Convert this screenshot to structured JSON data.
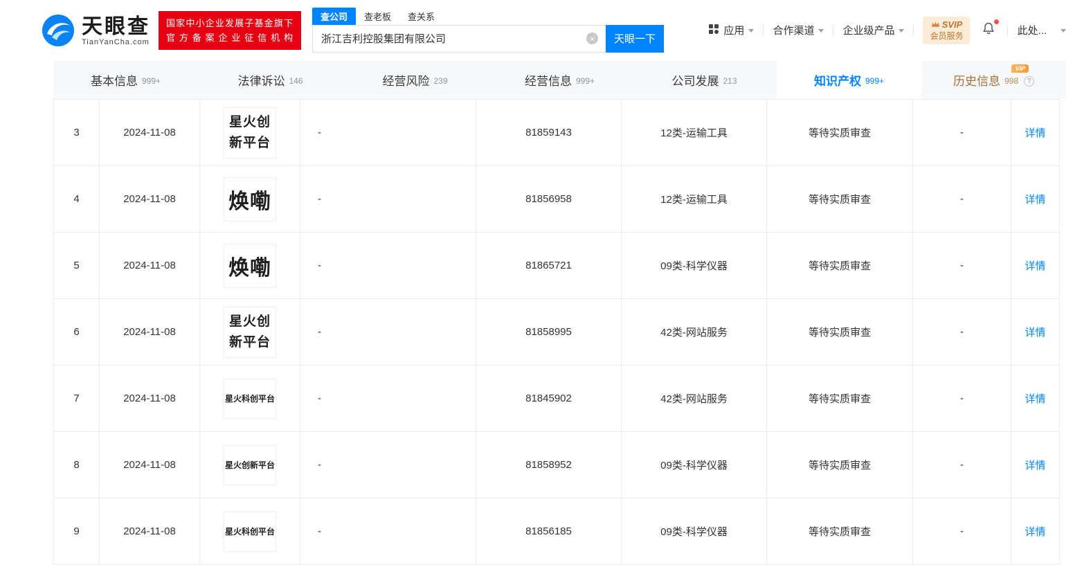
{
  "header": {
    "logo": {
      "brand_cn": "天眼查",
      "brand_en": "TianYanCha.com"
    },
    "badge": {
      "line1": "国家中小企业发展子基金旗下",
      "line2": "官方备案企业征信机构"
    },
    "search": {
      "tabs": [
        {
          "label": "查公司"
        },
        {
          "label": "查老板"
        },
        {
          "label": "查关系"
        }
      ],
      "value": "浙江吉利控股集团有限公司",
      "button_label": "天眼一下"
    },
    "nav": {
      "apps": "应用",
      "partners": "合作渠道",
      "enterprise": "企业级产品",
      "vip_line1": "SVIP",
      "vip_line2": "会员服务",
      "profile": "此处..."
    },
    "colors": {
      "accent_blue": "#0084ff",
      "badge_red": "#e60012"
    }
  },
  "icons": {
    "clear": "×",
    "help": "?"
  },
  "tabs": [
    {
      "label": "基本信息",
      "count": "999+"
    },
    {
      "label": "法律诉讼",
      "count": "146"
    },
    {
      "label": "经营风险",
      "count": "239"
    },
    {
      "label": "经营信息",
      "count": "999+"
    },
    {
      "label": "公司发展",
      "count": "213"
    },
    {
      "label": "知识产权",
      "count": "999+"
    },
    {
      "label": "历史信息",
      "count": "998",
      "vip_tag": "VIP"
    }
  ],
  "table": {
    "rows": [
      {
        "no": "3",
        "date": "2024-11-08",
        "mark": "星火创\n新平台",
        "variant": "stacked",
        "name": "-",
        "reg": "81859143",
        "cls": "12类-运输工具",
        "status": "等待实质审查",
        "extra": "-",
        "detail": "详情"
      },
      {
        "no": "4",
        "date": "2024-11-08",
        "mark": "焕嘞",
        "variant": "large",
        "name": "-",
        "reg": "81856958",
        "cls": "12类-运输工具",
        "status": "等待实质审查",
        "extra": "-",
        "detail": "详情"
      },
      {
        "no": "5",
        "date": "2024-11-08",
        "mark": "焕嘞",
        "variant": "large",
        "name": "-",
        "reg": "81865721",
        "cls": "09类-科学仪器",
        "status": "等待实质审查",
        "extra": "-",
        "detail": "详情"
      },
      {
        "no": "6",
        "date": "2024-11-08",
        "mark": "星火创\n新平台",
        "variant": "stacked",
        "name": "-",
        "reg": "81858995",
        "cls": "42类-网站服务",
        "status": "等待实质审查",
        "extra": "-",
        "detail": "详情"
      },
      {
        "no": "7",
        "date": "2024-11-08",
        "mark": "星火科创平台",
        "variant": "line",
        "name": "-",
        "reg": "81845902",
        "cls": "42类-网站服务",
        "status": "等待实质审查",
        "extra": "-",
        "detail": "详情"
      },
      {
        "no": "8",
        "date": "2024-11-08",
        "mark": "星火创新平台",
        "variant": "line",
        "name": "-",
        "reg": "81858952",
        "cls": "09类-科学仪器",
        "status": "等待实质审查",
        "extra": "-",
        "detail": "详情"
      },
      {
        "no": "9",
        "date": "2024-11-08",
        "mark": "星火科创平台",
        "variant": "line",
        "name": "-",
        "reg": "81856185",
        "cls": "09类-科学仪器",
        "status": "等待实质审查",
        "extra": "-",
        "detail": "详情"
      }
    ]
  }
}
